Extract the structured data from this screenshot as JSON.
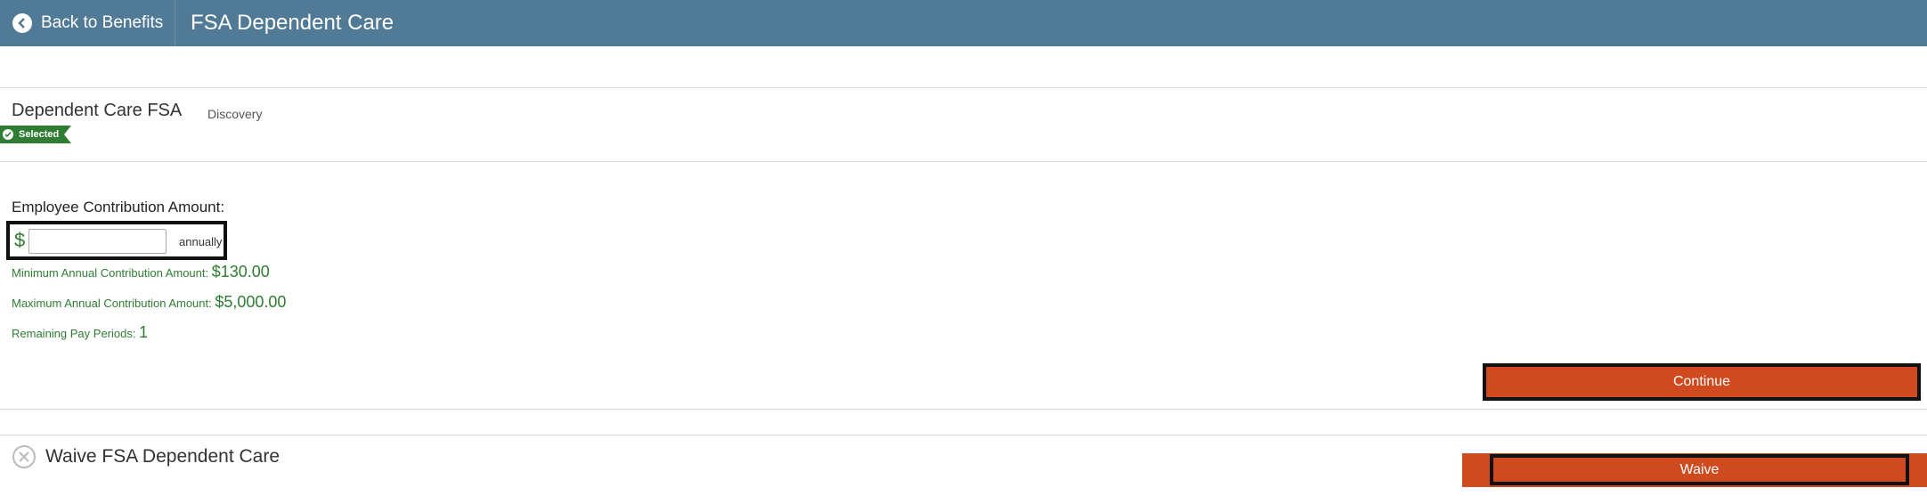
{
  "header": {
    "back_label": "Back to Benefits",
    "title": "FSA Dependent Care",
    "background_color": "#507a96"
  },
  "plan": {
    "name": "Dependent Care FSA",
    "provider": "Discovery",
    "status_badge": "Selected",
    "badge_color": "#2f7d32"
  },
  "contribution": {
    "label": "Employee Contribution Amount:",
    "currency_symbol": "$",
    "input_value": "",
    "period_label": "annually",
    "min_label": "Minimum Annual Contribution Amount: ",
    "min_value": "$130.00",
    "max_label": "Maximum Annual Contribution Amount: ",
    "max_value": "$5,000.00",
    "remaining_label": "Remaining Pay Periods: ",
    "remaining_value": "1"
  },
  "actions": {
    "continue_label": "Continue",
    "waive_section_title": "Waive FSA Dependent Care",
    "waive_label": "Waive",
    "accent_color": "#cf4b1f"
  },
  "icons": {
    "back": "chevron-left-circle-icon",
    "badge": "check-circle-icon",
    "waive": "close-circle-icon"
  }
}
